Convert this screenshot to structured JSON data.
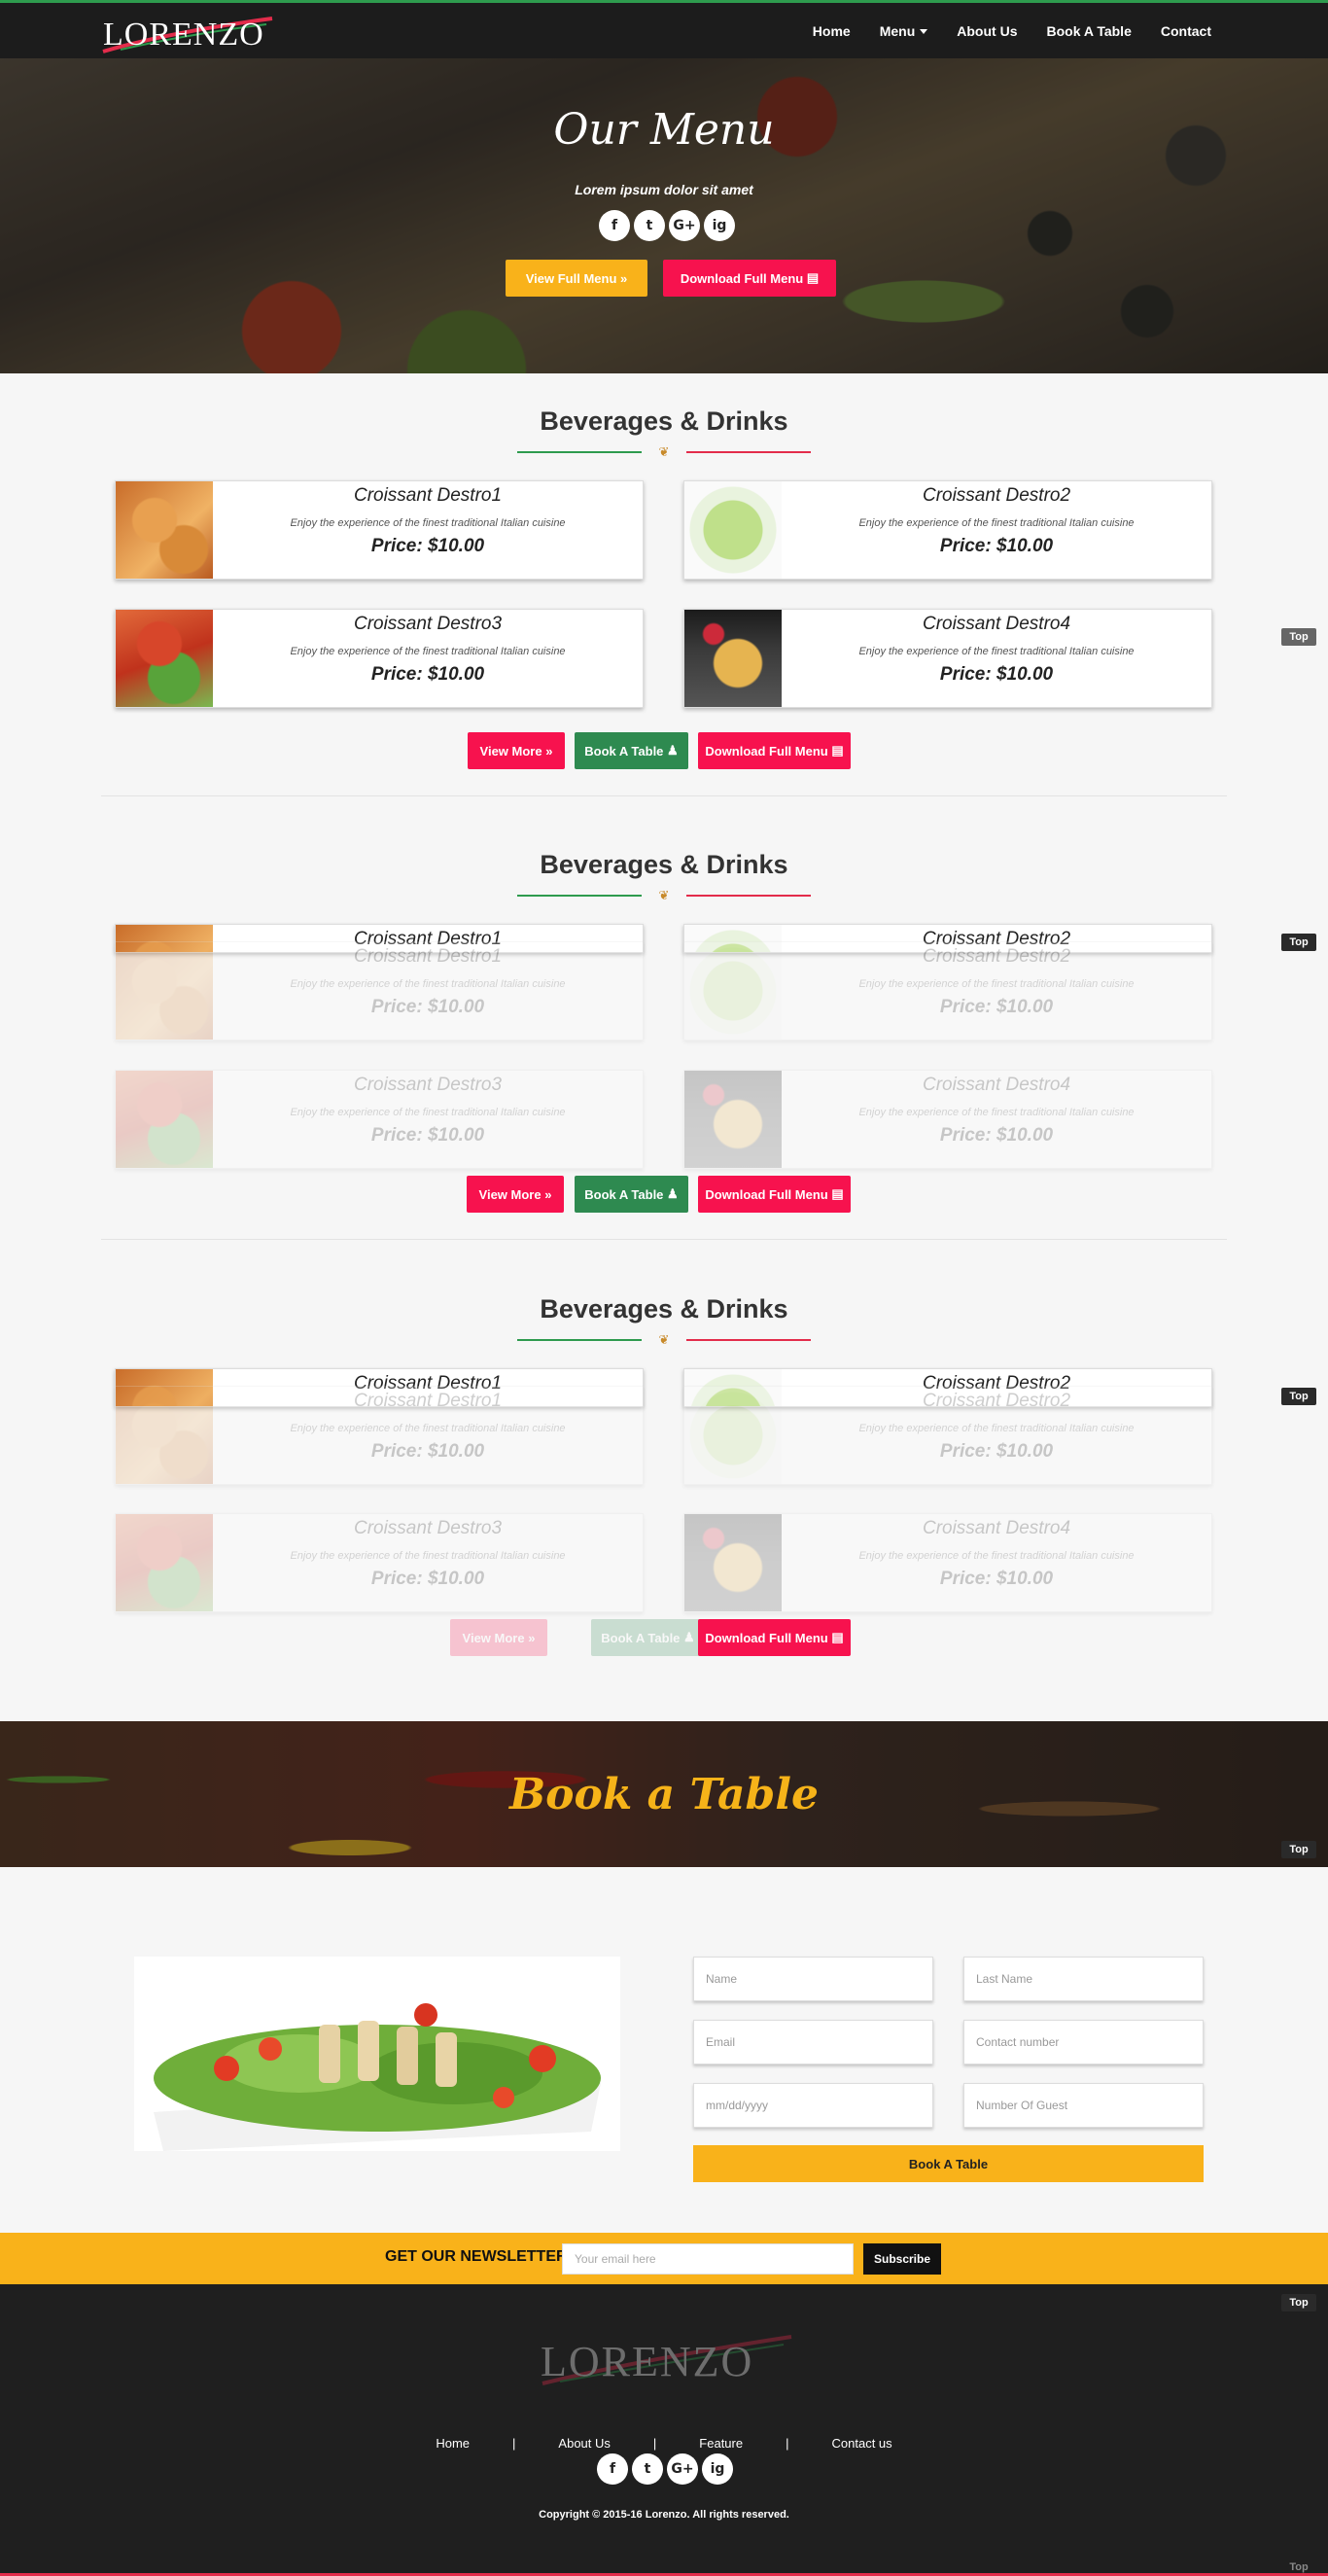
{
  "brand": {
    "logo_text": "LORENZO"
  },
  "nav": {
    "items": [
      {
        "label": "Home"
      },
      {
        "label": "Menu"
      },
      {
        "label": "About Us"
      },
      {
        "label": "Book A Table"
      },
      {
        "label": "Contact"
      }
    ]
  },
  "hero": {
    "title": "Our Menu",
    "subtitle": "Lorem ipsum dolor sit amet",
    "view_menu_label": "View Full Menu",
    "download_menu_label": "Download Full Menu"
  },
  "social": [
    "f",
    "t",
    "G+",
    "ig"
  ],
  "sections": [
    {
      "title": "Beverages & Drinks",
      "items": [
        {
          "name": "Croissant Destro1",
          "description": "Enjoy the experience of the finest traditional Italian cuisine",
          "price": "Price: $10.00"
        },
        {
          "name": "Croissant Destro2",
          "description": "Enjoy the experience of the finest traditional Italian cuisine",
          "price": "Price: $10.00"
        },
        {
          "name": "Croissant Destro3",
          "description": "Enjoy the experience of the finest traditional Italian cuisine",
          "price": "Price: $10.00"
        },
        {
          "name": "Croissant Destro4",
          "description": "Enjoy the experience of the finest traditional Italian cuisine",
          "price": "Price: $10.00"
        }
      ],
      "buttons": {
        "view_more": "View More",
        "book_table": "Book A Table",
        "download": "Download Full Menu"
      }
    },
    {
      "title": "Beverages & Drinks"
    },
    {
      "title": "Beverages & Drinks"
    }
  ],
  "top_label": "Top",
  "book_banner": {
    "title": "Book a Table"
  },
  "booking_form": {
    "name_placeholder": "Name",
    "last_name_placeholder": "Last Name",
    "email_placeholder": "Email",
    "contact_placeholder": "Contact number",
    "date_placeholder": "mm/dd/yyyy",
    "guests_placeholder": "Number Of Guest",
    "submit_label": "Book A Table"
  },
  "newsletter": {
    "label": "GET OUR NEWSLETTER",
    "placeholder": "Your email here",
    "button": "Subscribe"
  },
  "footer": {
    "links": [
      "Home",
      "About Us",
      "Feature",
      "Contact us"
    ],
    "separator": "|",
    "copyright": "Copyright © 2015-16 Lorenzo. All rights reserved."
  },
  "colors": {
    "accent_yellow": "#f9b21a",
    "accent_red": "#f7124e",
    "accent_green": "#2e8a50",
    "dark": "#1c1c1c"
  }
}
